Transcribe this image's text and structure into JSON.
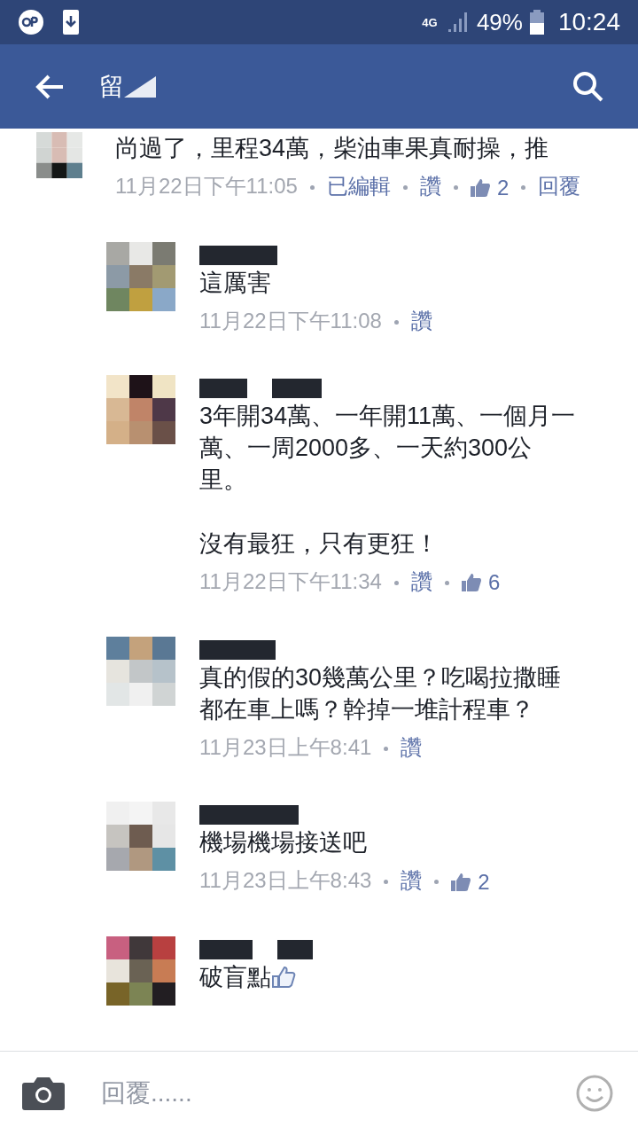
{
  "status_bar": {
    "network": "4G",
    "battery": "49%",
    "time": "10:24"
  },
  "app_bar": {
    "title": "留"
  },
  "comments": [
    {
      "reply": false,
      "text": "尚過了，里程34萬，柴油車果真耐操，推",
      "meta": [
        {
          "kind": "time",
          "text": "11月22日下午11:05"
        },
        {
          "kind": "link",
          "text": "已編輯"
        },
        {
          "kind": "link",
          "text": "讚"
        },
        {
          "kind": "likes",
          "text": "2"
        },
        {
          "kind": "link",
          "text": "回覆"
        }
      ]
    },
    {
      "reply": true,
      "text": "這厲害",
      "meta": [
        {
          "kind": "time",
          "text": "11月22日下午11:08"
        },
        {
          "kind": "link",
          "text": "讚"
        }
      ]
    },
    {
      "reply": true,
      "text": "3年開34萬、一年開11萬、一個月一萬、一周2000多、一天約300公里。",
      "text_2": "沒有最狂，只有更狂！",
      "meta": [
        {
          "kind": "time",
          "text": "11月22日下午11:34"
        },
        {
          "kind": "link",
          "text": "讚"
        },
        {
          "kind": "likes",
          "text": "6"
        }
      ]
    },
    {
      "reply": true,
      "text": "真的假的30幾萬公里？吃喝拉撒睡都在車上嗎？幹掉一堆計程車？",
      "meta": [
        {
          "kind": "time",
          "text": "11月23日上午8:41"
        },
        {
          "kind": "link",
          "text": "讚"
        }
      ]
    },
    {
      "reply": true,
      "text": "機場機場接送吧",
      "meta": [
        {
          "kind": "time",
          "text": "11月23日上午8:43"
        },
        {
          "kind": "link",
          "text": "讚"
        },
        {
          "kind": "likes",
          "text": "2"
        }
      ]
    },
    {
      "reply": true,
      "text": "破盲點",
      "thumb": true
    }
  ],
  "composer": {
    "placeholder": "回覆......"
  }
}
